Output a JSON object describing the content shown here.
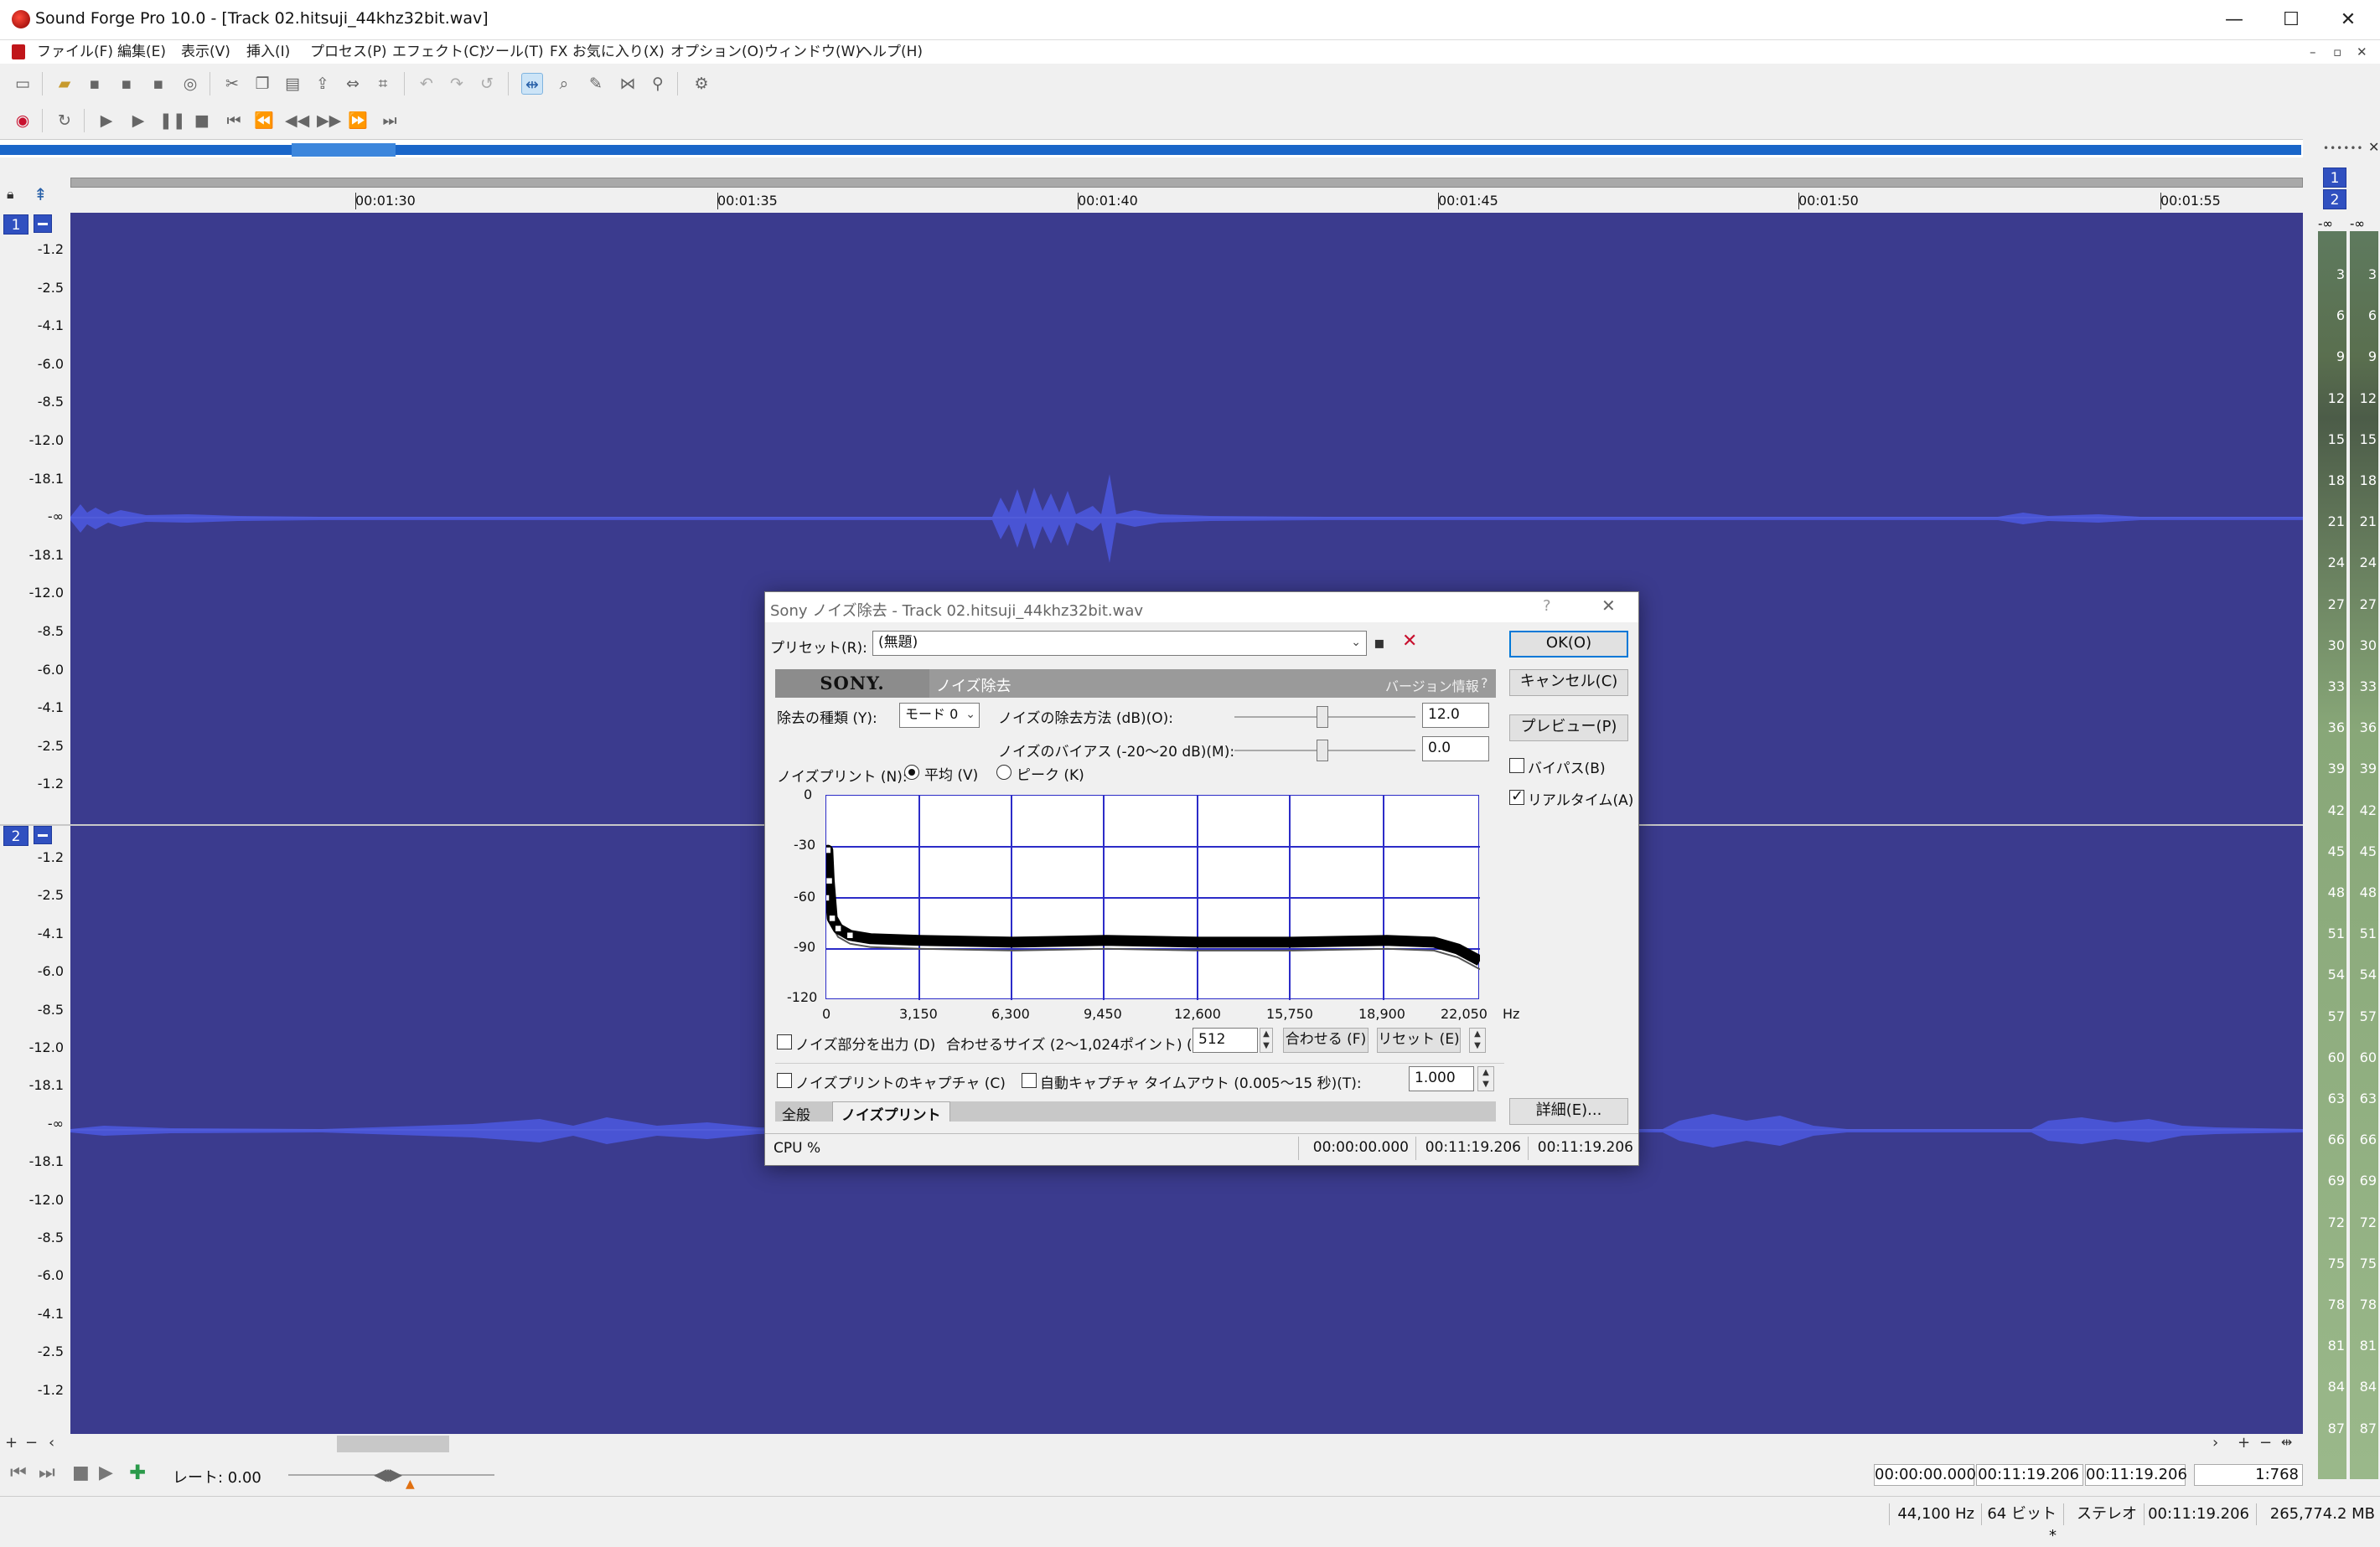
{
  "app": {
    "title": "Sound Forge Pro 10.0 - [Track 02.hitsuji_44khz32bit.wav]",
    "window_controls": {
      "minimize": "—",
      "maximize": "☐",
      "close": "✕"
    }
  },
  "menu": [
    "ファイル(F)",
    "編集(E)",
    "表示(V)",
    "挿入(I)",
    "プロセス(P)",
    "エフェクト(C)",
    "ツール(T)",
    "FX お気に入り(X)",
    "オプション(O)",
    "ウィンドウ(W)",
    "ヘルプ(H)"
  ],
  "timeline": {
    "ticks": [
      "00:01:30",
      "00:01:35",
      "00:01:40",
      "00:01:45",
      "00:01:50",
      "00:01:55"
    ]
  },
  "channels": [
    {
      "number": "1",
      "levels": [
        "-1.2",
        "-2.5",
        "-4.1",
        "-6.0",
        "-8.5",
        "-12.0",
        "-18.1",
        "-∞",
        "-18.1",
        "-12.0",
        "-8.5",
        "-6.0",
        "-4.1",
        "-2.5",
        "-1.2"
      ]
    },
    {
      "number": "2",
      "levels": [
        "-1.2",
        "-2.5",
        "-4.1",
        "-6.0",
        "-8.5",
        "-12.0",
        "-18.1",
        "-∞",
        "-18.1",
        "-12.0",
        "-8.5",
        "-6.0",
        "-4.1",
        "-2.5",
        "-1.2"
      ]
    }
  ],
  "vu_meter": {
    "channel_buttons": [
      "1",
      "2"
    ],
    "top_labels": [
      "-∞",
      "-∞"
    ],
    "scale": [
      "3",
      "6",
      "9",
      "12",
      "15",
      "18",
      "21",
      "24",
      "27",
      "30",
      "33",
      "36",
      "39",
      "42",
      "45",
      "48",
      "51",
      "54",
      "57",
      "60",
      "63",
      "66",
      "69",
      "72",
      "75",
      "78",
      "81",
      "84",
      "87"
    ]
  },
  "transport": {
    "rate_label": "レート: 0.00"
  },
  "time_display": {
    "start": "00:00:00.000",
    "end": "00:11:19.206",
    "length": "00:11:19.206",
    "zoom": "1:768"
  },
  "status": {
    "sample_rate": "44,100 Hz",
    "bit_depth": "64 ビット *",
    "channels": "ステレオ",
    "length": "00:11:19.206",
    "disk": "265,774.2 MB"
  },
  "dialog": {
    "title": "Sony ノイズ除去 - Track 02.hitsuji_44khz32bit.wav",
    "help": "?",
    "close": "✕",
    "preset_label": "プリセット(R):",
    "preset_value": "(無題)",
    "header_logo": "SONY.",
    "header_title": "ノイズ除去",
    "header_version": "バージョン情報",
    "header_help": "?",
    "removal_type_label": "除去の種類 (Y):",
    "removal_type_value": "モード 0",
    "method_label": "ノイズの除去方法 (dB)(O):",
    "method_value": "12.0",
    "bias_label": "ノイズのバイアス (-20〜20 dB)(M):",
    "bias_value": "0.0",
    "noiseprint_label": "ノイズプリント (N):",
    "radio_avg": "平均 (V)",
    "radio_peak": "ピーク (K)",
    "graph_y": [
      "0",
      "-30",
      "-60",
      "-90",
      "-120"
    ],
    "graph_x": [
      "0",
      "3,150",
      "6,300",
      "9,450",
      "12,600",
      "15,750",
      "18,900",
      "22,050"
    ],
    "graph_unit": "Hz",
    "output_noise_label": "ノイズ部分を出力 (D)",
    "fit_size_label": "合わせるサイズ (2〜1,024ポイント) (Z):",
    "fit_size_value": "512",
    "fit_button": "合わせる (F)",
    "reset_button": "リセット (E)",
    "capture_label": "ノイズプリントのキャプチャ (C)",
    "auto_capture_label": "自動キャプチャ タイムアウト (0.005〜15 秒)(T):",
    "auto_capture_value": "1.000",
    "tabs": [
      "全般",
      "ノイズプリント"
    ],
    "ok": "OK(O)",
    "cancel": "キャンセル(C)",
    "preview": "プレビュー(P)",
    "bypass": "バイパス(B)",
    "realtime": "リアルタイム(A)",
    "details": "詳細(E)...",
    "cpu": "CPU %",
    "time_start": "00:00:00.000",
    "time_end": "00:11:19.206",
    "time_length": "00:11:19.206",
    "chart_data": {
      "type": "line",
      "xlabel": "Hz",
      "xlim": [
        0,
        22050
      ],
      "ylim": [
        -120,
        0
      ],
      "series": [
        {
          "x": [
            0,
            50,
            100,
            200,
            400,
            800,
            1500,
            3150,
            6300,
            9450,
            12600,
            15750,
            18900,
            20500,
            21300,
            22050
          ],
          "values": [
            -60,
            -32,
            -50,
            -72,
            -78,
            -82,
            -84,
            -85,
            -86,
            -85,
            -86,
            -86,
            -85,
            -86,
            -90,
            -97
          ]
        }
      ]
    }
  }
}
